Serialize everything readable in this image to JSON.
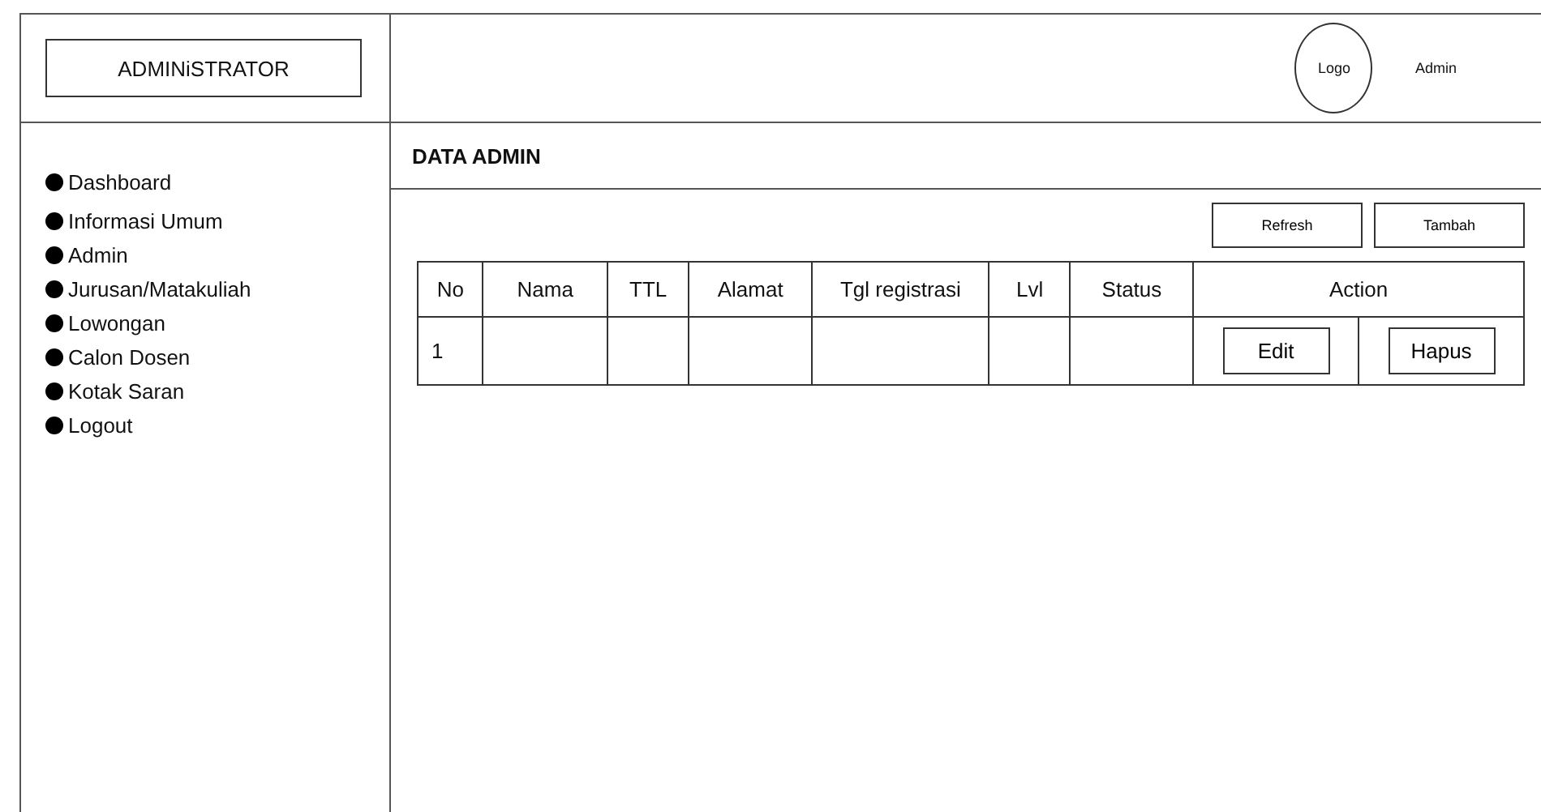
{
  "brand": "ADMINiSTRATOR",
  "header": {
    "logo": "Logo",
    "user": "Admin"
  },
  "sidebar": {
    "items": [
      {
        "label": "Dashboard"
      },
      {
        "label": "Informasi Umum"
      },
      {
        "label": "Admin"
      },
      {
        "label": "Jurusan/Matakuliah"
      },
      {
        "label": "Lowongan"
      },
      {
        "label": "Calon Dosen"
      },
      {
        "label": "Kotak Saran"
      },
      {
        "label": "Logout"
      }
    ]
  },
  "page_title": "DATA ADMIN",
  "toolbar": [
    "Refresh",
    "Tambah"
  ],
  "table": {
    "columns": [
      "No",
      "Nama",
      "TTL",
      "Alamat",
      "Tgl registrasi",
      "Lvl",
      "Status",
      "Action"
    ],
    "rows": [
      {
        "no": "1",
        "actions": [
          "Edit",
          "Hapus"
        ]
      }
    ]
  }
}
